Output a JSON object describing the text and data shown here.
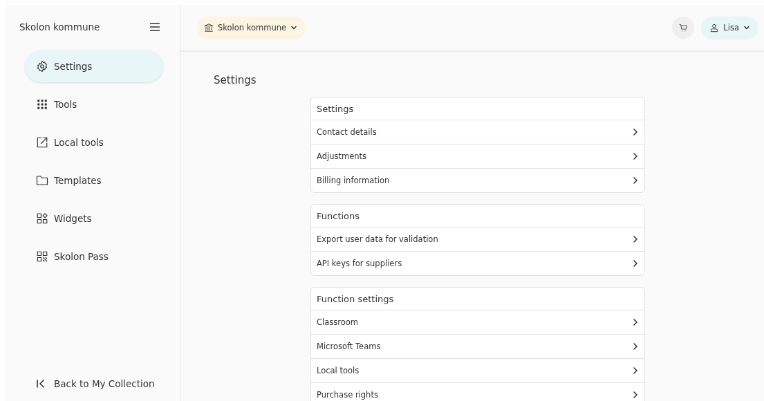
{
  "sidebar": {
    "title": "Skolon kommune",
    "items": [
      {
        "label": "Settings",
        "selected": true
      },
      {
        "label": "Tools",
        "selected": false
      },
      {
        "label": "Local tools",
        "selected": false
      },
      {
        "label": "Templates",
        "selected": false
      },
      {
        "label": "Widgets",
        "selected": false
      },
      {
        "label": "Skolon Pass",
        "selected": false
      }
    ],
    "back_link": "Back to My Collection"
  },
  "header": {
    "organization": "Skolon kommune",
    "user": "Lisa"
  },
  "page_title": "Settings",
  "sections": [
    {
      "title": "Settings",
      "items": [
        "Contact details",
        "Adjustments",
        "Billing information"
      ]
    },
    {
      "title": "Functions",
      "items": [
        "Export user data for validation",
        "API keys for suppliers"
      ]
    },
    {
      "title": "Function settings",
      "items": [
        "Classroom",
        "Microsoft Teams",
        "Local tools",
        "Purchase rights"
      ]
    }
  ]
}
